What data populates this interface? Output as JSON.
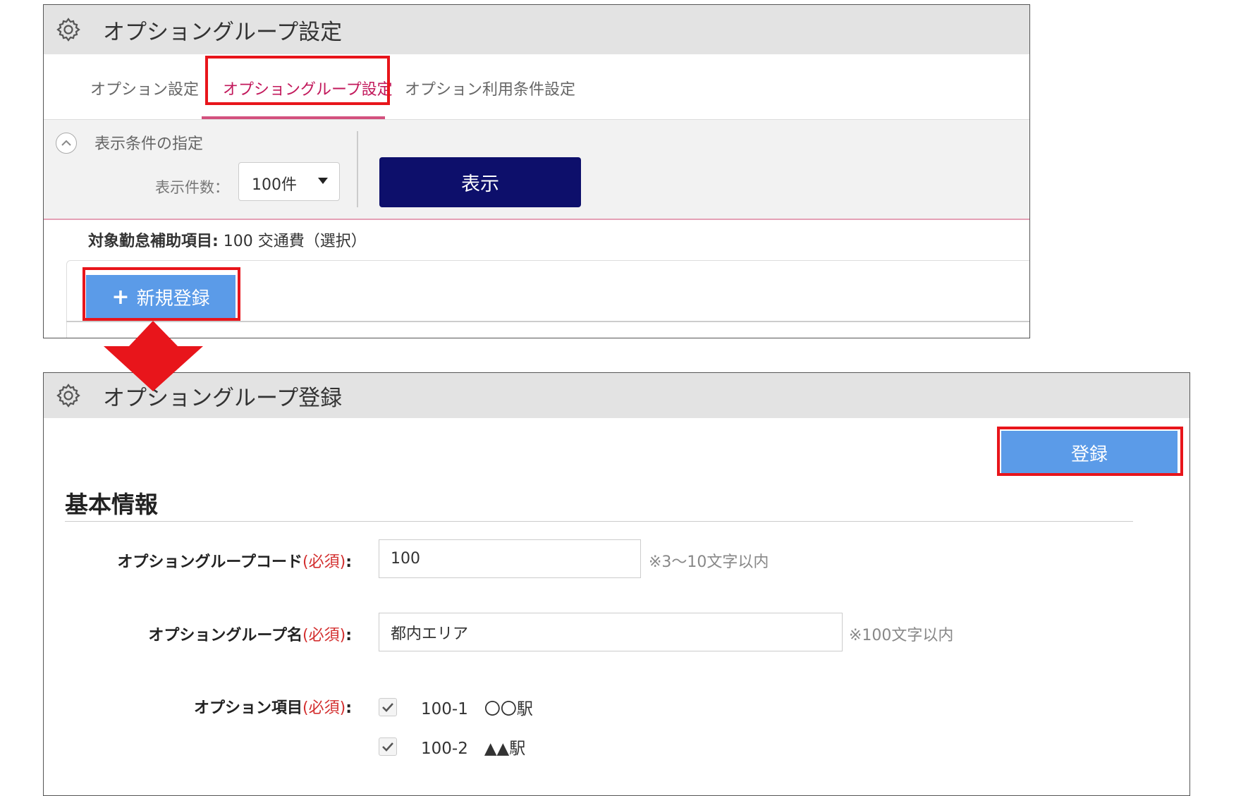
{
  "top_panel": {
    "title": "オプショングループ設定",
    "tabs": [
      {
        "label": "オプション設定",
        "active": false
      },
      {
        "label": "オプショングループ設定",
        "active": true
      },
      {
        "label": "オプション利用条件設定",
        "active": false
      }
    ],
    "filter": {
      "title": "表示条件の指定",
      "count_label": "表示件数：",
      "count_value": "100件",
      "show_button": "表示"
    },
    "target_label": "対象勤怠補助項目:",
    "target_value": " 100 交通費（選択）",
    "new_button": "新規登録"
  },
  "bottom_panel": {
    "title": "オプショングループ登録",
    "register_button": "登録",
    "section_title": "基本情報",
    "fields": {
      "code": {
        "label": "オプショングループコード",
        "required": "(必須)",
        "suffix": ":",
        "value": "100",
        "hint": "※3～10文字以内"
      },
      "name": {
        "label": "オプショングループ名",
        "required": "(必須)",
        "suffix": ":",
        "value": "都内エリア",
        "hint": "※100文字以内"
      },
      "items": {
        "label": "オプション項目",
        "required": "(必須)",
        "suffix": ":",
        "options": [
          {
            "text": "100-1　〇〇駅",
            "checked": true
          },
          {
            "text": "100-2　▲▲駅",
            "checked": true
          }
        ]
      }
    }
  },
  "colors": {
    "highlight": "#e8151b",
    "primary_dark": "#0d0f6b",
    "primary_light": "#5b9be8",
    "active_tab": "#c2185b",
    "required": "#d32f2f"
  }
}
